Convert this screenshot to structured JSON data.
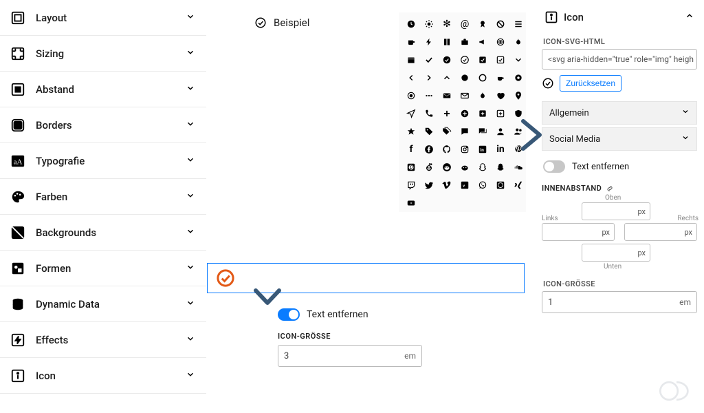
{
  "nav": [
    {
      "label": "Layout"
    },
    {
      "label": "Sizing"
    },
    {
      "label": "Abstand"
    },
    {
      "label": "Borders"
    },
    {
      "label": "Typografie"
    },
    {
      "label": "Farben"
    },
    {
      "label": "Backgrounds"
    },
    {
      "label": "Formen"
    },
    {
      "label": "Dynamic Data"
    },
    {
      "label": "Effects"
    },
    {
      "label": "Icon"
    }
  ],
  "sample_label": "Beispiel",
  "center": {
    "toggle_label": "Text entfernen",
    "size_heading": "ICON-GRÖSSE",
    "size_value": "3",
    "size_unit": "em"
  },
  "inspector": {
    "panel_title": "Icon",
    "svg_field_label": "ICON-SVG-HTML",
    "svg_value": "<svg aria-hidden=\"true\" role=\"img\" heigh",
    "reset_label": "Zurücksetzen",
    "acc_general": "Allgemein",
    "acc_social": "Social Media",
    "remove_text_label": "Text entfernen",
    "padding_heading": "INNENABSTAND",
    "pad_labels": {
      "top": "Oben",
      "left": "Links",
      "right": "Rechts",
      "bottom": "Unten"
    },
    "pad_unit": "px",
    "size_heading": "ICON-GRÖSSE",
    "size_value": "1",
    "size_unit": "em"
  }
}
